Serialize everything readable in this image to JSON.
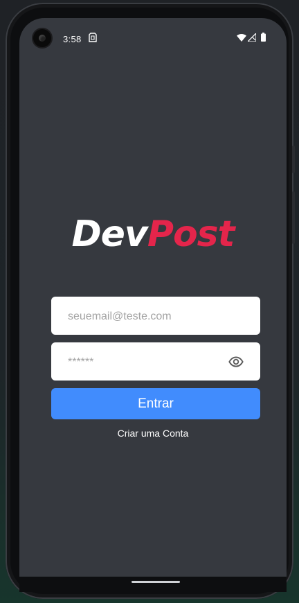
{
  "status_bar": {
    "time": "3:58"
  },
  "logo": {
    "part1": "Dev",
    "part2": "Post",
    "colors": {
      "part1": "#ffffff",
      "part2": "#e4254b"
    }
  },
  "email_field": {
    "value": "",
    "placeholder": "seuemail@teste.com"
  },
  "password_field": {
    "value": "",
    "placeholder": "******",
    "toggle_icon": "eye-icon"
  },
  "login_button": {
    "label": "Entrar",
    "color": "#418cfd"
  },
  "create_account_link": {
    "label": "Criar uma Conta"
  },
  "theme": {
    "background": "#36393f"
  }
}
